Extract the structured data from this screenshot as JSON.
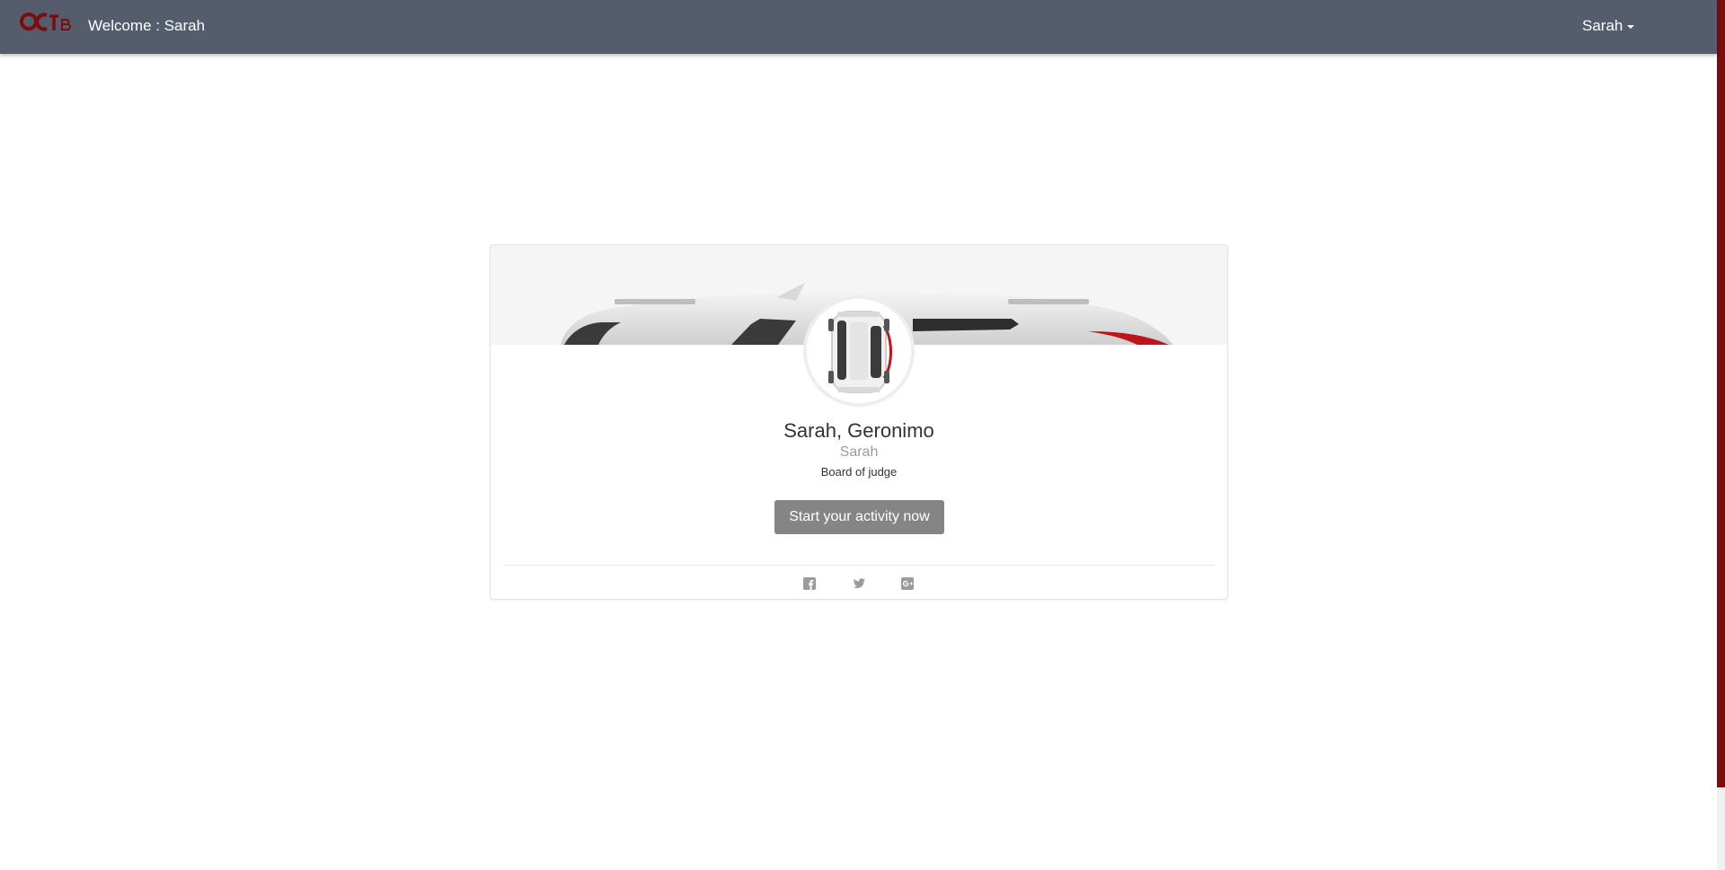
{
  "header": {
    "brand_icon": "octb-logo-icon",
    "welcome_text": "Welcome : Sarah",
    "user_menu_label": "Sarah",
    "user_menu_icon": "caret-down-icon",
    "bar_color": "#555d6c"
  },
  "profile": {
    "full_name": "Sarah, Geronimo",
    "username": "Sarah",
    "role": "Board of judge",
    "cta_label": "Start your activity now",
    "avatar_icon": "car-top-view-icon",
    "cover_icon": "car-side-view-icon"
  },
  "social": [
    {
      "icon": "facebook-icon"
    },
    {
      "icon": "twitter-icon"
    },
    {
      "icon": "google-plus-icon"
    }
  ],
  "colors": {
    "accent": "#7a0d0d",
    "button": "#858585"
  }
}
